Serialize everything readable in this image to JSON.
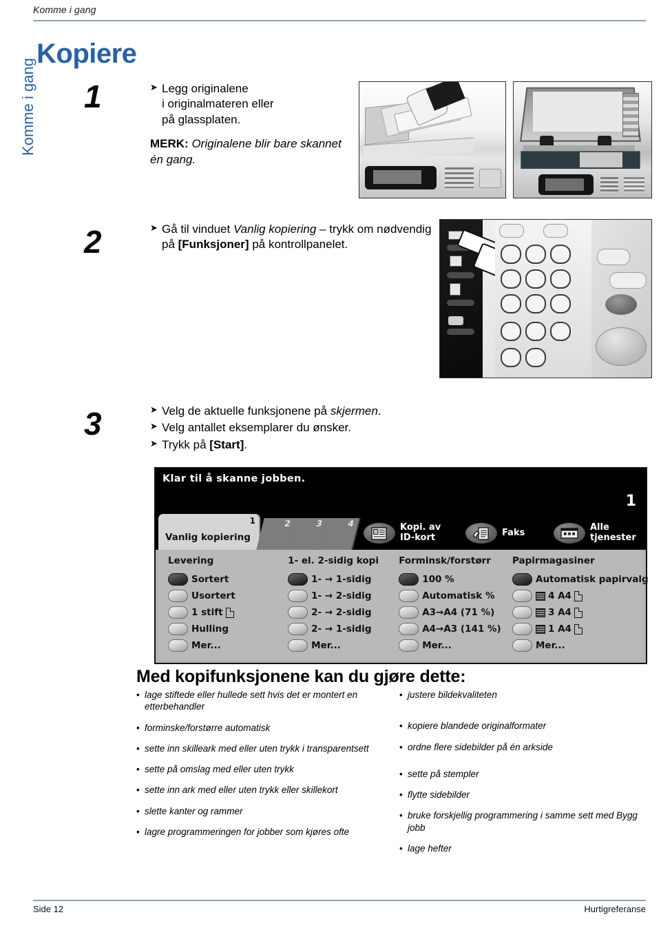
{
  "header": {
    "running_head": "Komme i gang"
  },
  "sidebar": {
    "tab_label": "Komme i gang"
  },
  "title": "Kopiere",
  "steps": [
    {
      "number": "1",
      "bullets": [
        "Legg originalene\ni originalmateren eller\npå glassplaten."
      ],
      "note_label": "MERK:",
      "note_text": "Originalene blir bare skannet én gang."
    },
    {
      "number": "2",
      "lead": "Gå til vinduet ",
      "emph": "Vanlig kopiering",
      "mid": " – trykk om nødvendig på ",
      "strong": "[Funksjoner]",
      "tail": " på kontrollpanelet."
    },
    {
      "number": "3",
      "b1_pre": "Velg de aktuelle funksjonene på ",
      "b1_em": "skjermen",
      "b1_post": ".",
      "b2": "Velg antallet eksemplarer du ønsker.",
      "b3_pre": "Trykk på ",
      "b3_strong": "[Start]",
      "b3_post": "."
    }
  ],
  "photos": {
    "feeder_alt": "document-feeder-photo",
    "glass_alt": "document-glass-photo",
    "panel_alt": "control-panel-keypad-photo"
  },
  "screen": {
    "status_message": "Klar til å skanne jobben.",
    "quantity": "1",
    "active_tab": {
      "label": "Vanlig kopiering",
      "number": "1"
    },
    "dim_tabs": [
      "2",
      "3",
      "4"
    ],
    "services": [
      {
        "label": "Kopi. av\nID-kort",
        "icon": "id-card-icon"
      },
      {
        "label": "Faks",
        "icon": "fax-icon"
      },
      {
        "label": "Alle\ntjenester",
        "icon": "all-services-icon"
      }
    ],
    "columns": [
      {
        "heading": "Levering",
        "options": [
          {
            "label": "Sortert",
            "selected": true
          },
          {
            "label": "Usortert",
            "selected": false
          },
          {
            "label": "1 stift",
            "selected": false,
            "sheet": true
          },
          {
            "label": "Hulling",
            "selected": false
          },
          {
            "label": "Mer...",
            "selected": false
          }
        ]
      },
      {
        "heading": "1- el. 2-sidig kopi",
        "options": [
          {
            "label": "1- → 1-sidig",
            "selected": true
          },
          {
            "label": "1- → 2-sidig",
            "selected": false
          },
          {
            "label": "2- → 2-sidig",
            "selected": false
          },
          {
            "label": "2- → 1-sidig",
            "selected": false
          },
          {
            "label": "Mer...",
            "selected": false
          }
        ]
      },
      {
        "heading": "Forminsk/forstørr",
        "options": [
          {
            "label": "100 %",
            "selected": true
          },
          {
            "label": "Automatisk %",
            "selected": false
          },
          {
            "label": "A3→A4 (71 %)",
            "selected": false
          },
          {
            "label": "A4→A3 (141 %)",
            "selected": false
          },
          {
            "label": "Mer...",
            "selected": false
          }
        ]
      },
      {
        "heading": "Papirmagasiner",
        "options": [
          {
            "label": "Automatisk papirvalg",
            "selected": true
          },
          {
            "label": "4 A4",
            "selected": false,
            "tray": true,
            "sheet": true
          },
          {
            "label": "3 A4",
            "selected": false,
            "tray": true,
            "sheet": true
          },
          {
            "label": "1 A4",
            "selected": false,
            "tray": true,
            "sheet": true
          },
          {
            "label": "Mer...",
            "selected": false
          }
        ]
      }
    ]
  },
  "features": {
    "heading": "Med kopifunksjonene kan du gjøre dette:",
    "left": [
      "lage stiftede eller hullede sett hvis det er montert en etterbehandler",
      "forminske/forstørre automatisk",
      "sette inn skilleark med eller uten trykk i transparentsett",
      "sette på omslag med eller uten trykk",
      "sette inn ark med eller uten trykk eller skillekort",
      "slette kanter og rammer",
      "lagre programmeringen for jobber som kjøres ofte"
    ],
    "right": [
      "justere bildekvaliteten",
      "kopiere blandede originalformater",
      "ordne flere sidebilder på én arkside",
      "sette på stempler",
      "flytte sidebilder",
      "bruke forskjellig programmering i samme sett med Bygg jobb",
      "lage hefter"
    ]
  },
  "footer": {
    "left": "Side 12",
    "right": "Hurtigreferanse"
  },
  "colors": {
    "accent_blue": "#2a62a2",
    "rule_blue": "#8ba0b8"
  }
}
